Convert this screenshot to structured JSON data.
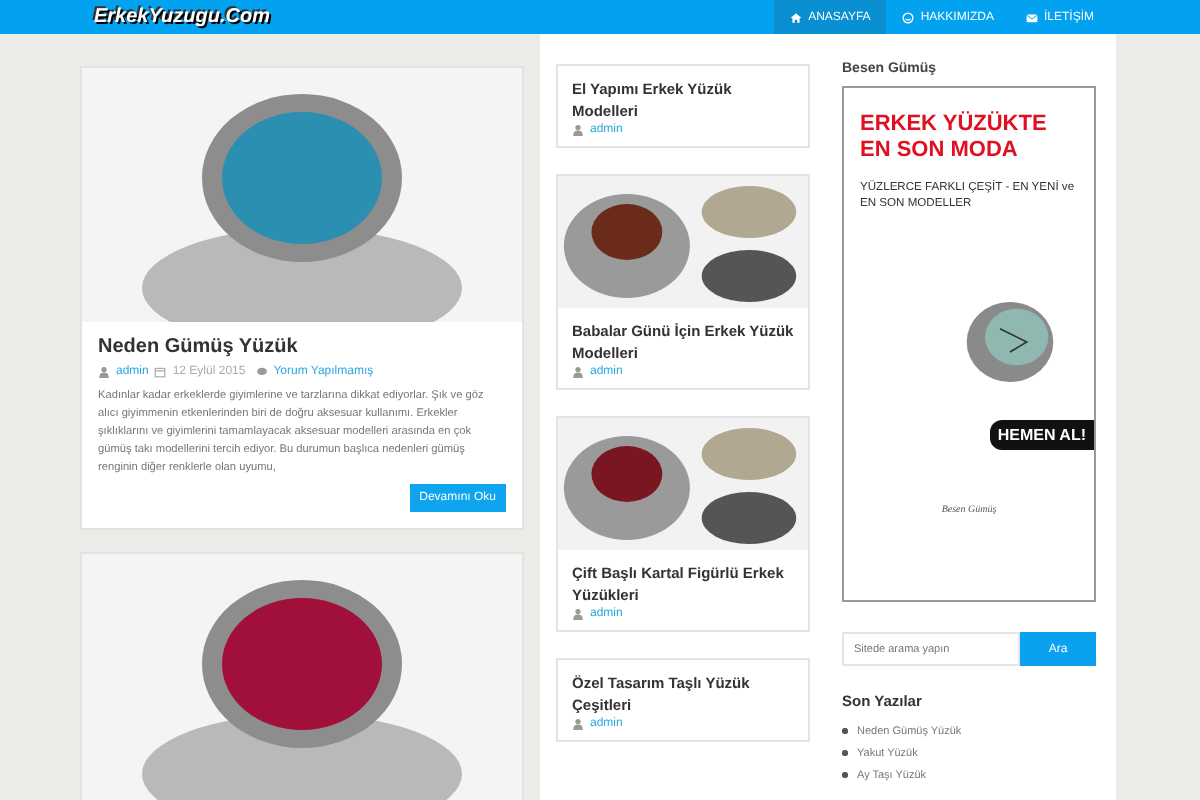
{
  "header": {
    "logo": "ErkekYuzugu.Com",
    "nav": [
      {
        "label": "ANASAYFA",
        "kind": "home",
        "selected": true
      },
      {
        "label": "HAKKIMIZDA",
        "kind": "about",
        "selected": false
      },
      {
        "label": "İLETİŞİM",
        "kind": "contact",
        "selected": false
      }
    ]
  },
  "featured": [
    {
      "title": "Neden Gümüş Yüzük",
      "author": "admin",
      "date": "12 Eylül 2015",
      "comments": "Yorum Yapılmamış",
      "excerpt": "Kadınlar kadar erkeklerde giyimlerine ve tarzlarına dikkat ediyorlar. Şık ve göz alıcı giyimmenin etkenlerinden biri de doğru aksesuar kullanımı. Erkekler şıklıklarını ve giyimlerini tamamlayacak aksesuar modelleri arasında en çok gümüş takı modellerini tercih ediyor. Bu durumun başlıca nedenleri gümüş renginin diğer renklerle olan uyumu,",
      "button": "Devamını Oku",
      "kind": "full"
    },
    {
      "kind": "image"
    }
  ],
  "posts": [
    {
      "title": "El Yapımı Erkek Yüzük Modelleri",
      "author": "admin",
      "image": false
    },
    {
      "title": "Babalar Günü İçin Erkek Yüzük Modelleri",
      "author": "admin",
      "image": true
    },
    {
      "title": "Çift Başlı Kartal Figürlü Erkek Yüzükleri",
      "author": "admin",
      "image": true
    },
    {
      "title": "Özel Tasarım Taşlı Yüzük Çeşitleri",
      "author": "admin",
      "image": false
    }
  ],
  "sidebar": {
    "ad_title": "Besen Gümüş",
    "ad": {
      "headline": "ERKEK YÜZÜKTE EN SON MODA",
      "subline": "YÜZLERCE FARKLI ÇEŞİT - EN YENİ ve EN SON MODELLER",
      "cta": "HEMEN AL!",
      "brand": "Besen Gümüş"
    },
    "search": {
      "placeholder": "Sitede arama yapın",
      "button": "Ara"
    },
    "recent_title": "Son Yazılar",
    "recent": [
      "Neden Gümüş Yüzük",
      "Yakut Yüzük",
      "Ay Taşı Yüzük"
    ]
  }
}
